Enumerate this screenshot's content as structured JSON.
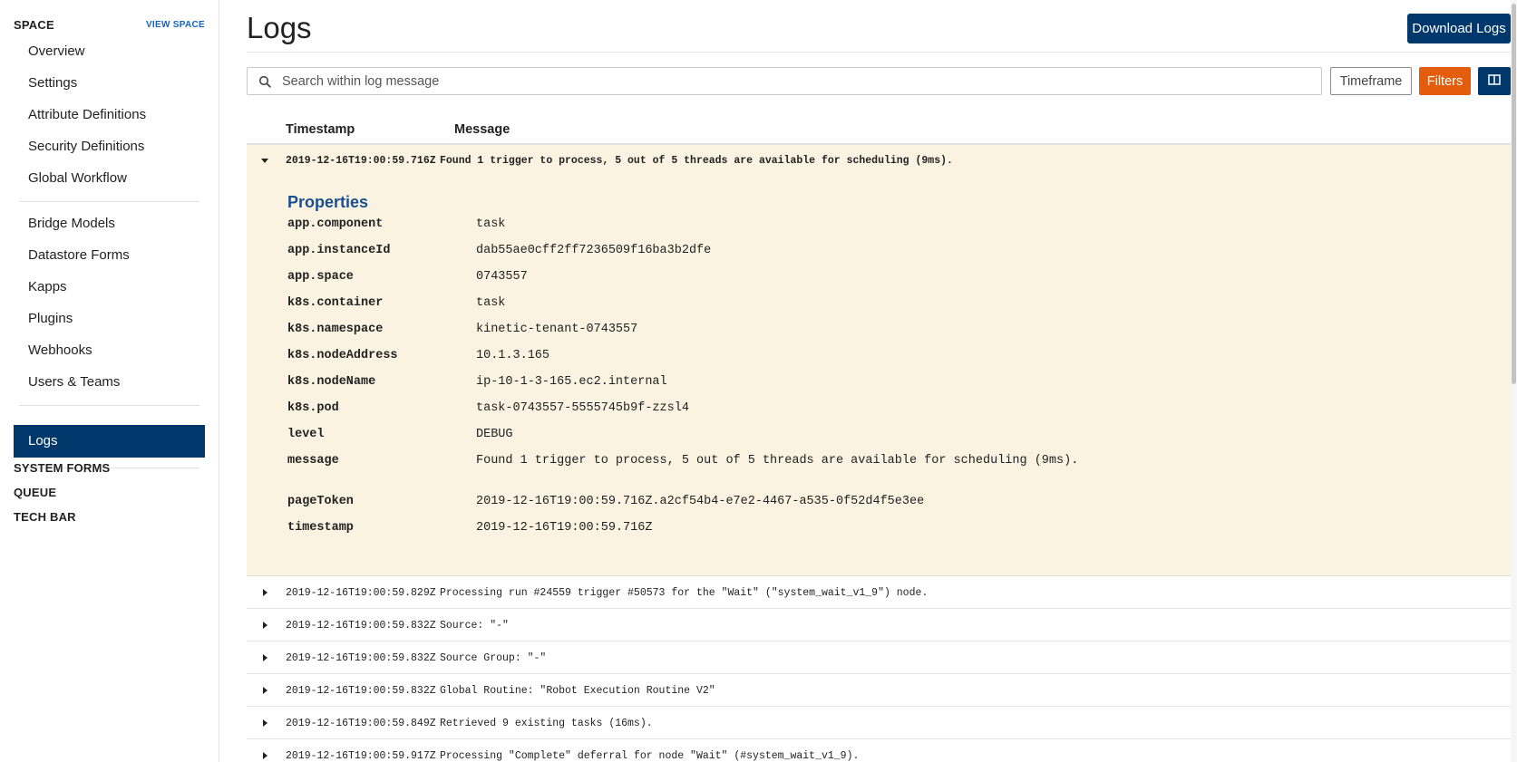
{
  "sidebar": {
    "title": "SPACE",
    "view_link": "VIEW SPACE",
    "group1": [
      "Overview",
      "Settings",
      "Attribute Definitions",
      "Security Definitions",
      "Global Workflow"
    ],
    "group2": [
      "Bridge Models",
      "Datastore Forms",
      "Kapps",
      "Plugins",
      "Webhooks",
      "Users & Teams"
    ],
    "active": "Logs",
    "sections": [
      "SYSTEM FORMS",
      "QUEUE",
      "TECH BAR"
    ]
  },
  "header": {
    "title": "Logs",
    "download_label": "Download Logs"
  },
  "toolbar": {
    "search_placeholder": "Search within log message",
    "search_value": "",
    "timeframe_label": "Timeframe",
    "filters_label": "Filters",
    "columns_icon": "columns-icon"
  },
  "table": {
    "headers": [
      "Timestamp",
      "Message"
    ],
    "expanded": {
      "timestamp": "2019-12-16T19:00:59.716Z",
      "message": "Found 1 trigger to process, 5 out of 5 threads are available for scheduling (9ms).",
      "properties_title": "Properties",
      "properties": [
        {
          "key": "app.component",
          "value": "task"
        },
        {
          "key": "app.instanceId",
          "value": "dab55ae0cff2ff7236509f16ba3b2dfe"
        },
        {
          "key": "app.space",
          "value": "0743557"
        },
        {
          "key": "k8s.container",
          "value": "task"
        },
        {
          "key": "k8s.namespace",
          "value": "kinetic-tenant-0743557"
        },
        {
          "key": "k8s.nodeAddress",
          "value": "10.1.3.165"
        },
        {
          "key": "k8s.nodeName",
          "value": "ip-10-1-3-165.ec2.internal"
        },
        {
          "key": "k8s.pod",
          "value": "task-0743557-5555745b9f-zzsl4"
        },
        {
          "key": "level",
          "value": "DEBUG"
        },
        {
          "key": "message",
          "value": "Found 1 trigger to process, 5 out of 5 threads are available for scheduling (9ms)."
        },
        {
          "key": "pageToken",
          "value": "2019-12-16T19:00:59.716Z.a2cf54b4-e7e2-4467-a535-0f52d4f5e3ee"
        },
        {
          "key": "timestamp",
          "value": "2019-12-16T19:00:59.716Z"
        }
      ]
    },
    "rows": [
      {
        "timestamp": "2019-12-16T19:00:59.829Z",
        "message": "Processing run #24559 trigger #50573 for the \"Wait\" (\"system_wait_v1_9\") node."
      },
      {
        "timestamp": "2019-12-16T19:00:59.832Z",
        "message": "Source: \"-\""
      },
      {
        "timestamp": "2019-12-16T19:00:59.832Z",
        "message": "Source Group: \"-\""
      },
      {
        "timestamp": "2019-12-16T19:00:59.832Z",
        "message": "Global Routine: \"Robot Execution Routine V2\""
      },
      {
        "timestamp": "2019-12-16T19:00:59.849Z",
        "message": "Retrieved 9 existing tasks (16ms)."
      },
      {
        "timestamp": "2019-12-16T19:00:59.917Z",
        "message": "Processing \"Complete\" deferral for node \"Wait\" (#system_wait_v1_9)."
      }
    ]
  },
  "colors": {
    "primary": "#00386b",
    "accent": "#e35d0c",
    "expanded_bg": "#fbf3e2",
    "properties_title": "#1a4f8f"
  }
}
